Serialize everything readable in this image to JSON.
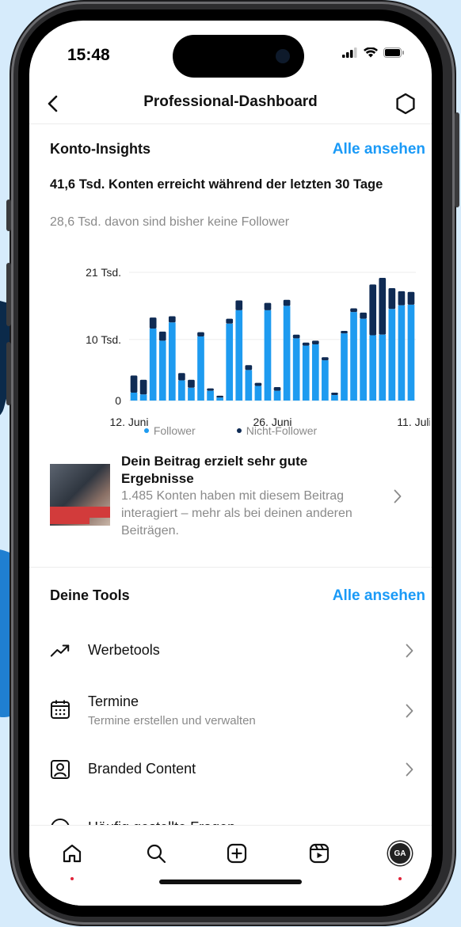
{
  "status": {
    "time": "15:48"
  },
  "nav": {
    "title": "Professional-Dashboard"
  },
  "insights": {
    "title": "Konto-Insights",
    "link": "Alle ansehen",
    "reach": "41,6 Tsd. Konten erreicht während der letzten 30 Tage",
    "sub": "28,6 Tsd. davon sind bisher keine Follower"
  },
  "chart_data": {
    "type": "bar",
    "stacked": true,
    "x_tick_labels": [
      "12. Juni",
      "26. Juni",
      "11. Juli"
    ],
    "y_tick_labels": [
      "0",
      "10 Tsd.",
      "21 Tsd."
    ],
    "ylim": [
      0,
      21
    ],
    "y_unit": "Tsd.",
    "grid": true,
    "legend_placement": "bottom-center",
    "series": [
      {
        "name": "Follower",
        "color": "#1e9bf0",
        "values": [
          1.3,
          1.0,
          11.8,
          9.8,
          12.8,
          3.3,
          2.1,
          10.5,
          1.6,
          0.5,
          12.6,
          14.8,
          5.0,
          2.4,
          14.8,
          1.6,
          15.5,
          10.2,
          9.0,
          9.2,
          6.6,
          0.9,
          11.0,
          14.5,
          13.4,
          10.7,
          10.8,
          15.0,
          15.6,
          15.7
        ]
      },
      {
        "name": "Nicht-Follower",
        "color": "#0f2b54",
        "values": [
          2.8,
          2.4,
          1.8,
          1.5,
          1.0,
          1.2,
          1.3,
          0.7,
          0.4,
          0.3,
          0.8,
          1.6,
          0.8,
          0.5,
          1.2,
          0.6,
          1.0,
          0.6,
          0.5,
          0.6,
          0.5,
          0.4,
          0.4,
          0.6,
          1.0,
          8.3,
          9.3,
          3.4,
          2.3,
          2.1
        ]
      }
    ]
  },
  "post": {
    "title": "Dein Beitrag erzielt sehr gute Ergebnisse",
    "desc": "1.485 Konten haben mit diesem Beitrag interagiert – mehr als bei deinen anderen Beiträgen."
  },
  "tools": {
    "title": "Deine Tools",
    "link": "Alle ansehen",
    "items": [
      {
        "label": "Werbetools",
        "sub": ""
      },
      {
        "label": "Termine",
        "sub": "Termine erstellen und verwalten"
      },
      {
        "label": "Branded Content",
        "sub": ""
      },
      {
        "label": "Häufig gestellte Fragen",
        "sub": ""
      }
    ]
  },
  "tabbar": {
    "avatar_initials": "GA"
  }
}
